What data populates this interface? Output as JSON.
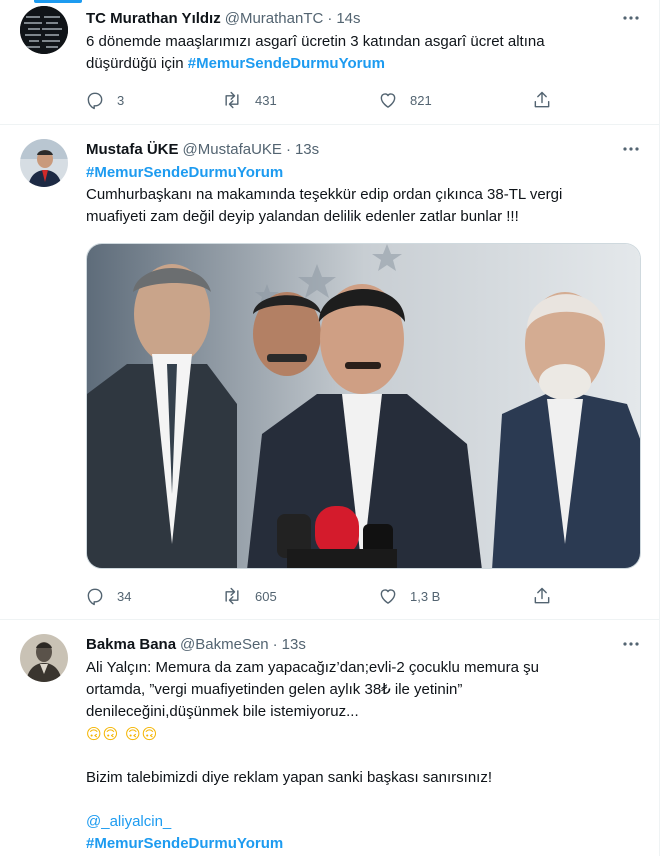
{
  "tweets": [
    {
      "name": "TC Murathan Yıldız",
      "handle": "@MurathanTC",
      "time": "14s",
      "line1": "6 dönemde maaşlarımızı asgarî ücretin 3 katından asgarî ücret altına",
      "line2_prefix": "düşürdüğü için ",
      "hashtag": "#MemurSendeDurmuYorum",
      "replies": "3",
      "retweets": "431",
      "likes": "821"
    },
    {
      "name": "Mustafa ÜKE",
      "handle": "@MustafaUKE",
      "time": "13s",
      "hashtag": "#MemurSendeDurmuYorum",
      "line1": "Cumhurbaşkanı na makamında teşekkür edip ordan çıkınca 38-TL vergi",
      "line2": "muafiyeti zam değil deyip yalandan delilik edenler zatlar bunlar !!!",
      "replies": "34",
      "retweets": "605",
      "likes": "1,3 B"
    },
    {
      "name": "Bakma Bana",
      "handle": "@BakmeSen",
      "time": "13s",
      "line1": "Ali Yalçın: Memura da zam yapacağız’dan;evli-2 çocuklu memura şu",
      "line2": "ortamda, ”vergi muafiyetinden gelen aylık 38₺ ile yetinin”",
      "line3": "denileceğini,düşünmek bile istemiyoruz...",
      "emojis": "🙃🙃 🙃🙃",
      "line4": "Bizim talebimizdi diye reklam yapan sanki başkası sanırsınız!",
      "mention": "@_aliyalcin_",
      "hashtag": "#MemurSendeDurmuYorum"
    }
  ],
  "separator": "·",
  "colors": {
    "accent": "#1d9bf0",
    "text": "#0f1419",
    "muted": "#536471",
    "border": "#eff3f4"
  },
  "icons": [
    "reply-icon",
    "retweet-icon",
    "like-icon",
    "share-icon",
    "more-icon"
  ]
}
